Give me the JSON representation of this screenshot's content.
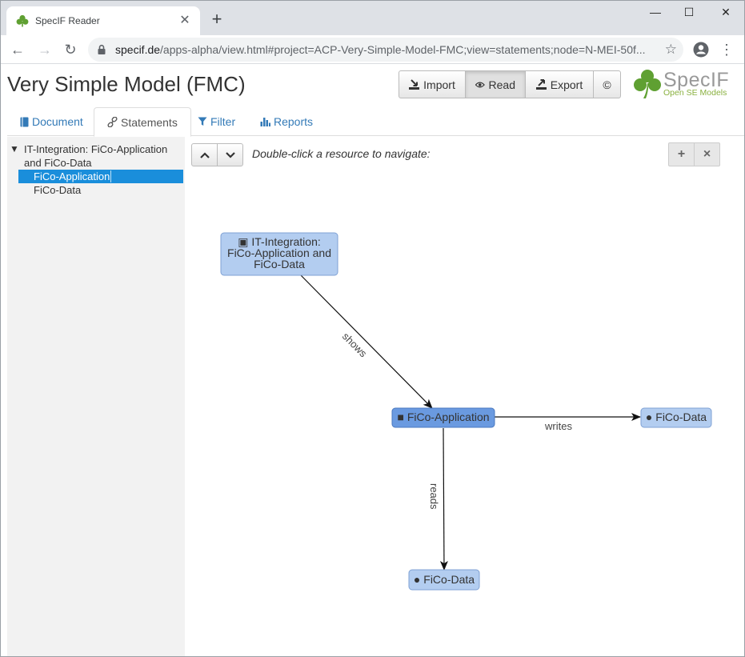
{
  "browser": {
    "tab_title": "SpecIF Reader",
    "url_host": "specif.de",
    "url_path": "/apps-alpha/view.html#project=ACP-Very-Simple-Model-FMC;view=statements;node=N-MEI-50f...",
    "new_tab_symbol": "+",
    "close_symbol": "✕",
    "back_symbol": "←",
    "forward_symbol": "→",
    "reload_symbol": "↻",
    "star_symbol": "☆",
    "menu_symbol": "⋮",
    "minimize_symbol": "—",
    "maximize_symbol": "☐",
    "window_close_symbol": "✕"
  },
  "page": {
    "title": "Very Simple Model (FMC)"
  },
  "actions": {
    "import_label": "Import",
    "read_label": "Read",
    "export_label": "Export",
    "copyright_label": "©"
  },
  "logo": {
    "text": "SpecIF",
    "subtitle": "Open SE Models",
    "color": "#5fa032"
  },
  "tabs": {
    "document": "Document",
    "statements": "Statements",
    "filter": "Filter",
    "reports": "Reports"
  },
  "tree": {
    "root_label": "IT-Integration: FiCo-Application and FiCo-Data",
    "children": [
      "FiCo-Application",
      "FiCo-Data"
    ],
    "selected_index": 0,
    "caret": "▼"
  },
  "graph": {
    "hint": "Double-click a resource to navigate:",
    "zoom_in": "+",
    "close": "×",
    "nodes": {
      "diagram": [
        "▣ IT-Integration:",
        "FiCo-Application and",
        "FiCo-Data"
      ],
      "application": "■ FiCo-Application",
      "data_right": "● FiCo-Data",
      "data_bottom": "● FiCo-Data"
    },
    "edges": {
      "shows": "shows",
      "writes": "writes",
      "reads": "reads"
    }
  },
  "colors": {
    "accent_link": "#337ab7",
    "selection": "#1a8edb",
    "node_fill": "#b3cdf0",
    "node_main_fill": "#6a9ae0"
  }
}
